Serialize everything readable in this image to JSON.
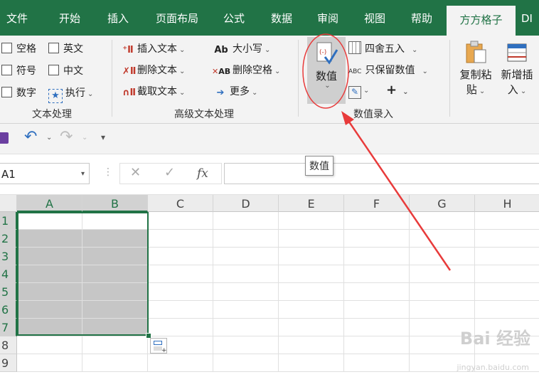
{
  "tabs": [
    {
      "label": "文件"
    },
    {
      "label": "开始"
    },
    {
      "label": "插入"
    },
    {
      "label": "页面布局"
    },
    {
      "label": "公式"
    },
    {
      "label": "数据"
    },
    {
      "label": "审阅"
    },
    {
      "label": "视图"
    },
    {
      "label": "帮助"
    },
    {
      "label": "方方格子",
      "active": true
    },
    {
      "label": "DI"
    }
  ],
  "ribbon": {
    "text_group": {
      "label": "文本处理",
      "checks": {
        "space": "空格",
        "english": "英文",
        "symbol": "符号",
        "chinese": "中文",
        "number": "数字"
      },
      "execute": "执行"
    },
    "advanced_group": {
      "label": "高级文本处理",
      "insert_text": "插入文本",
      "delete_text": "删除文本",
      "cut_text": "截取文本",
      "case": "大小写",
      "delete_space": "删除空格",
      "more": "更多"
    },
    "value_group": {
      "label": "数值录入",
      "value_button": "数值",
      "round": "四舍五入",
      "keep_value": "只保留数值"
    },
    "clip_group": {
      "copy_paste": "复制粘",
      "copy_paste_2": "贴",
      "new_insert": "新增插",
      "new_insert_2": "入"
    }
  },
  "formula_bar": {
    "name_box": "A1",
    "fx": "fx",
    "cancel": "✕",
    "confirm": "✓"
  },
  "tooltip": "数值",
  "grid": {
    "columns": [
      "A",
      "B",
      "C",
      "D",
      "E",
      "F",
      "G",
      "H"
    ],
    "rows": [
      "1",
      "2",
      "3",
      "4",
      "5",
      "6",
      "7",
      "8",
      "9"
    ]
  },
  "watermark": {
    "main": "Bai 经验",
    "sub": "jingyan.baidu.com"
  },
  "colors": {
    "excel_green": "#217346",
    "annotation_red": "#e83b3b",
    "selection_gray": "#c6c6c6"
  }
}
